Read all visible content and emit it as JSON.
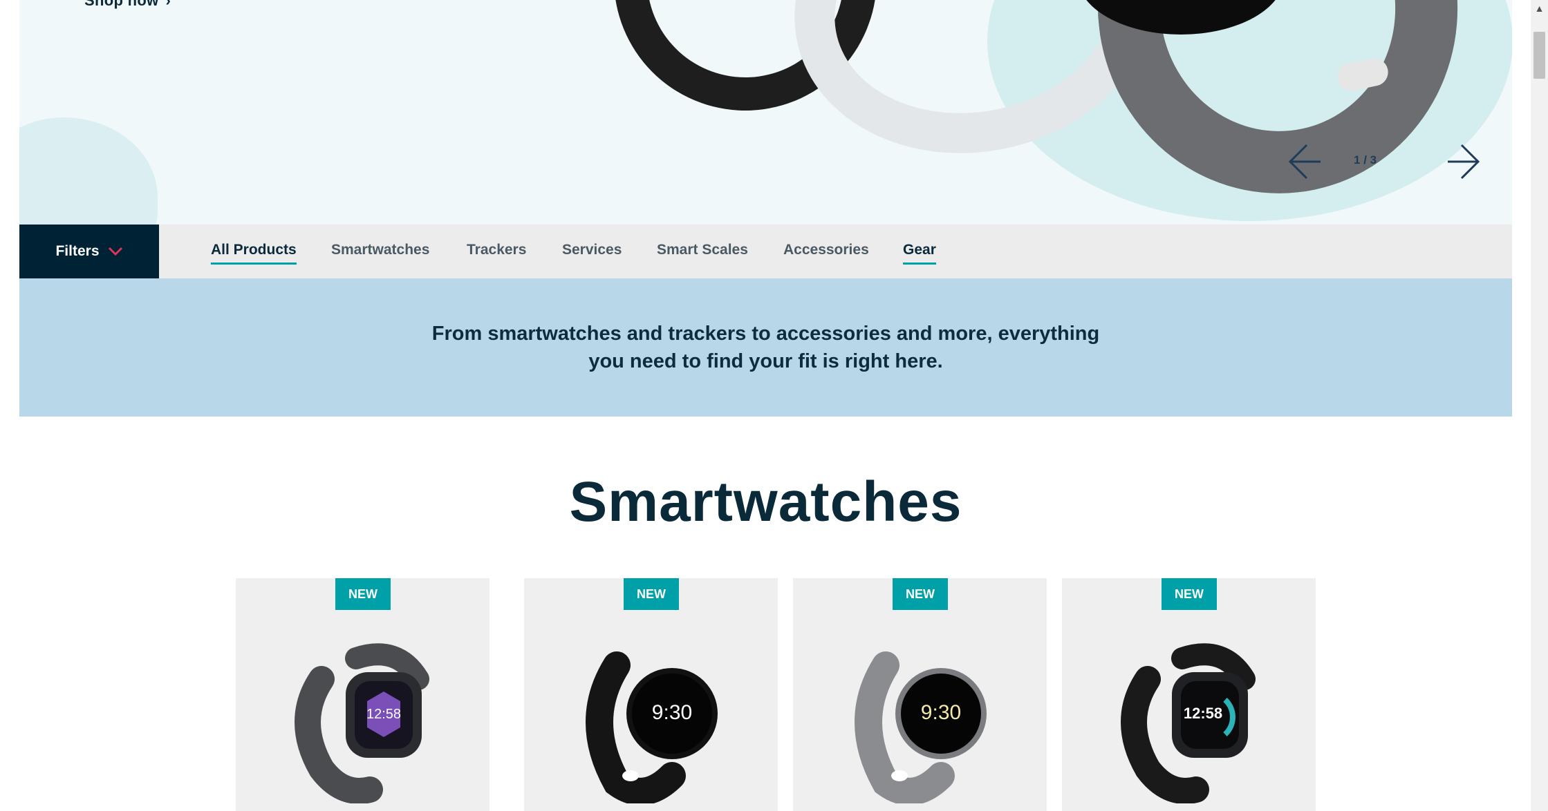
{
  "hero": {
    "shop_now": "Shop now",
    "carousel": {
      "current": "1",
      "separator": "/",
      "total": "3"
    }
  },
  "filters": {
    "label": "Filters"
  },
  "nav": {
    "items": [
      {
        "label": "All Products"
      },
      {
        "label": "Smartwatches"
      },
      {
        "label": "Trackers"
      },
      {
        "label": "Services"
      },
      {
        "label": "Smart Scales"
      },
      {
        "label": "Accessories"
      },
      {
        "label": "Gear"
      }
    ]
  },
  "intro": {
    "text": "From smartwatches and trackers to accessories and more, everything you need to find your fit is right here."
  },
  "section": {
    "title": "Smartwatches"
  },
  "products": [
    {
      "badge": "NEW",
      "time": "12:58"
    },
    {
      "badge": "NEW",
      "time": "9:30"
    },
    {
      "badge": "NEW",
      "time": "9:30"
    },
    {
      "badge": "NEW",
      "time": "12:58"
    }
  ],
  "colors": {
    "accent": "#00a0a8",
    "navy": "#002235",
    "intro_bg": "#b8d7e9",
    "filter_chevron": "#e0325a"
  },
  "icons": {
    "filters": "chevron-down-icon",
    "carousel_prev": "arrow-left-icon",
    "carousel_next": "arrow-right-icon",
    "shop_now": "chevron-right-icon"
  }
}
